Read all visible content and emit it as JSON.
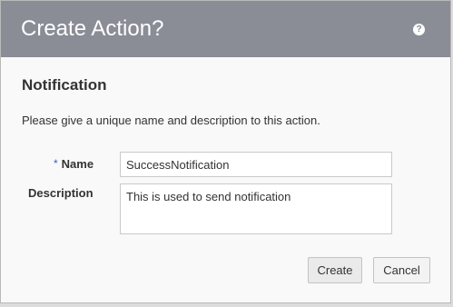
{
  "dialog": {
    "title": "Create Action?",
    "help_icon": "question-circle-icon",
    "section_title": "Notification",
    "instructions": "Please give a unique name and description to this action."
  },
  "form": {
    "name": {
      "required_marker": "*",
      "label": "Name",
      "value": "SuccessNotification"
    },
    "description": {
      "label": "Description",
      "value": "This is used to send notification"
    }
  },
  "buttons": {
    "create": "Create",
    "cancel": "Cancel"
  },
  "colors": {
    "titlebar": "#8a8c96",
    "required": "#2a66c7"
  }
}
